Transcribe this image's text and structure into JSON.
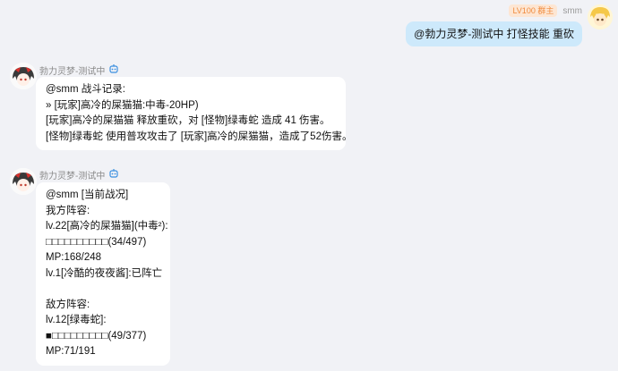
{
  "user_message": {
    "badge": "LV100 群主",
    "username": "smm",
    "text": "@勃力灵梦-测试中  打怪技能 重砍"
  },
  "bot_messages": [
    {
      "sender": "勃力灵梦-测试中",
      "lines": [
        "@smm 战斗记录:",
        "» [玩家]高冷的屎猫猫:中毒-20HP)",
        "[玩家]高冷的屎猫猫 释放重砍，对 [怪物]绿毒蛇 造成 41 伤害。",
        "[怪物]绿毒蛇 使用普攻攻击了 [玩家]高冷的屎猫猫，造成了52伤害。"
      ]
    },
    {
      "sender": "勃力灵梦-测试中",
      "lines": [
        "@smm [当前战况]",
        "我方阵容:",
        "lv.22[高冷的屎猫猫](中毒²):",
        "□□□□□□□□□□(34/497)",
        "MP:168/248",
        "lv.1[冷酷的夜夜酱]:已阵亡",
        "",
        "敌方阵容:",
        "lv.12[绿毒蛇]:",
        "■□□□□□□□□□(49/377)",
        "MP:71/191"
      ]
    }
  ],
  "icons": {
    "bot_badge": "robot-icon",
    "accent": "#3b8fe0"
  }
}
